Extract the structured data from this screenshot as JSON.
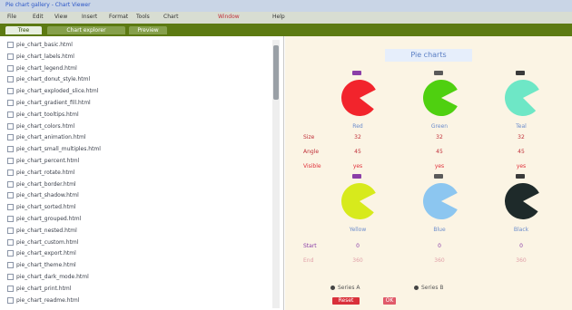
{
  "window": {
    "title": "Pie chart gallery - Chart Viewer"
  },
  "menu": {
    "items": [
      "File",
      "Edit",
      "View",
      "Insert",
      "Format",
      "Tools",
      "Chart",
      "Window",
      "Help"
    ],
    "active_index": 7
  },
  "tabs": [
    {
      "label": "Tree"
    },
    {
      "label": "Chart explorer"
    },
    {
      "label": "Preview"
    }
  ],
  "tree": {
    "items": [
      "pie_chart_basic.html",
      "pie_chart_labels.html",
      "pie_chart_legend.html",
      "pie_chart_donut_style.html",
      "pie_chart_exploded_slice.html",
      "pie_chart_gradient_fill.html",
      "pie_chart_tooltips.html",
      "pie_chart_colors.html",
      "pie_chart_animation.html",
      "pie_chart_small_multiples.html",
      "pie_chart_percent.html",
      "pie_chart_rotate.html",
      "pie_chart_border.html",
      "pie_chart_shadow.html",
      "pie_chart_sorted.html",
      "pie_chart_grouped.html",
      "pie_chart_nested.html",
      "pie_chart_custom.html",
      "pie_chart_export.html",
      "pie_chart_theme.html",
      "pie_chart_dark_mode.html",
      "pie_chart_print.html",
      "pie_chart_readme.html"
    ]
  },
  "panel": {
    "title": "Pie charts",
    "charts": [
      {
        "caption": "Red",
        "color": "#f2242c",
        "tag_color": "#8b3fa8",
        "fraction_shown": 0.82
      },
      {
        "caption": "Green",
        "color": "#4fd010",
        "tag_color": "#5a5a5a",
        "fraction_shown": 0.85
      },
      {
        "caption": "Teal",
        "color": "#6ee7c6",
        "tag_color": "#3a3a3a",
        "fraction_shown": 0.8
      },
      {
        "caption": "Yellow",
        "color": "#d7ea1c",
        "tag_color": "#8b3fa8",
        "fraction_shown": 0.82
      },
      {
        "caption": "Blue",
        "color": "#8cc6f0",
        "tag_color": "#5a5a5a",
        "fraction_shown": 0.85
      },
      {
        "caption": "Black",
        "color": "#1e2a2a",
        "tag_color": "#3a3a3a",
        "fraction_shown": 0.83
      }
    ],
    "stats_top": [
      {
        "label": "Size",
        "color": "#c0303a",
        "values": [
          "32",
          "32",
          "32"
        ]
      },
      {
        "label": "Angle",
        "color": "#c0303a",
        "values": [
          "45",
          "45",
          "45"
        ]
      },
      {
        "label": "Visible",
        "color": "#e0303a",
        "values": [
          "yes",
          "yes",
          "yes"
        ]
      }
    ],
    "stats_bottom": [
      {
        "label": "Start",
        "color": "#8b3fa8",
        "values": [
          "0",
          "0",
          "0"
        ]
      },
      {
        "label": "End",
        "color": "#e0a0a8",
        "values": [
          "360",
          "360",
          "360"
        ]
      }
    ],
    "legend": [
      "Series A",
      "Series B"
    ],
    "buttons": [
      {
        "label": "Reset",
        "color": "#d9303a"
      },
      {
        "label": "OK",
        "color": "#e05a6a"
      }
    ]
  }
}
